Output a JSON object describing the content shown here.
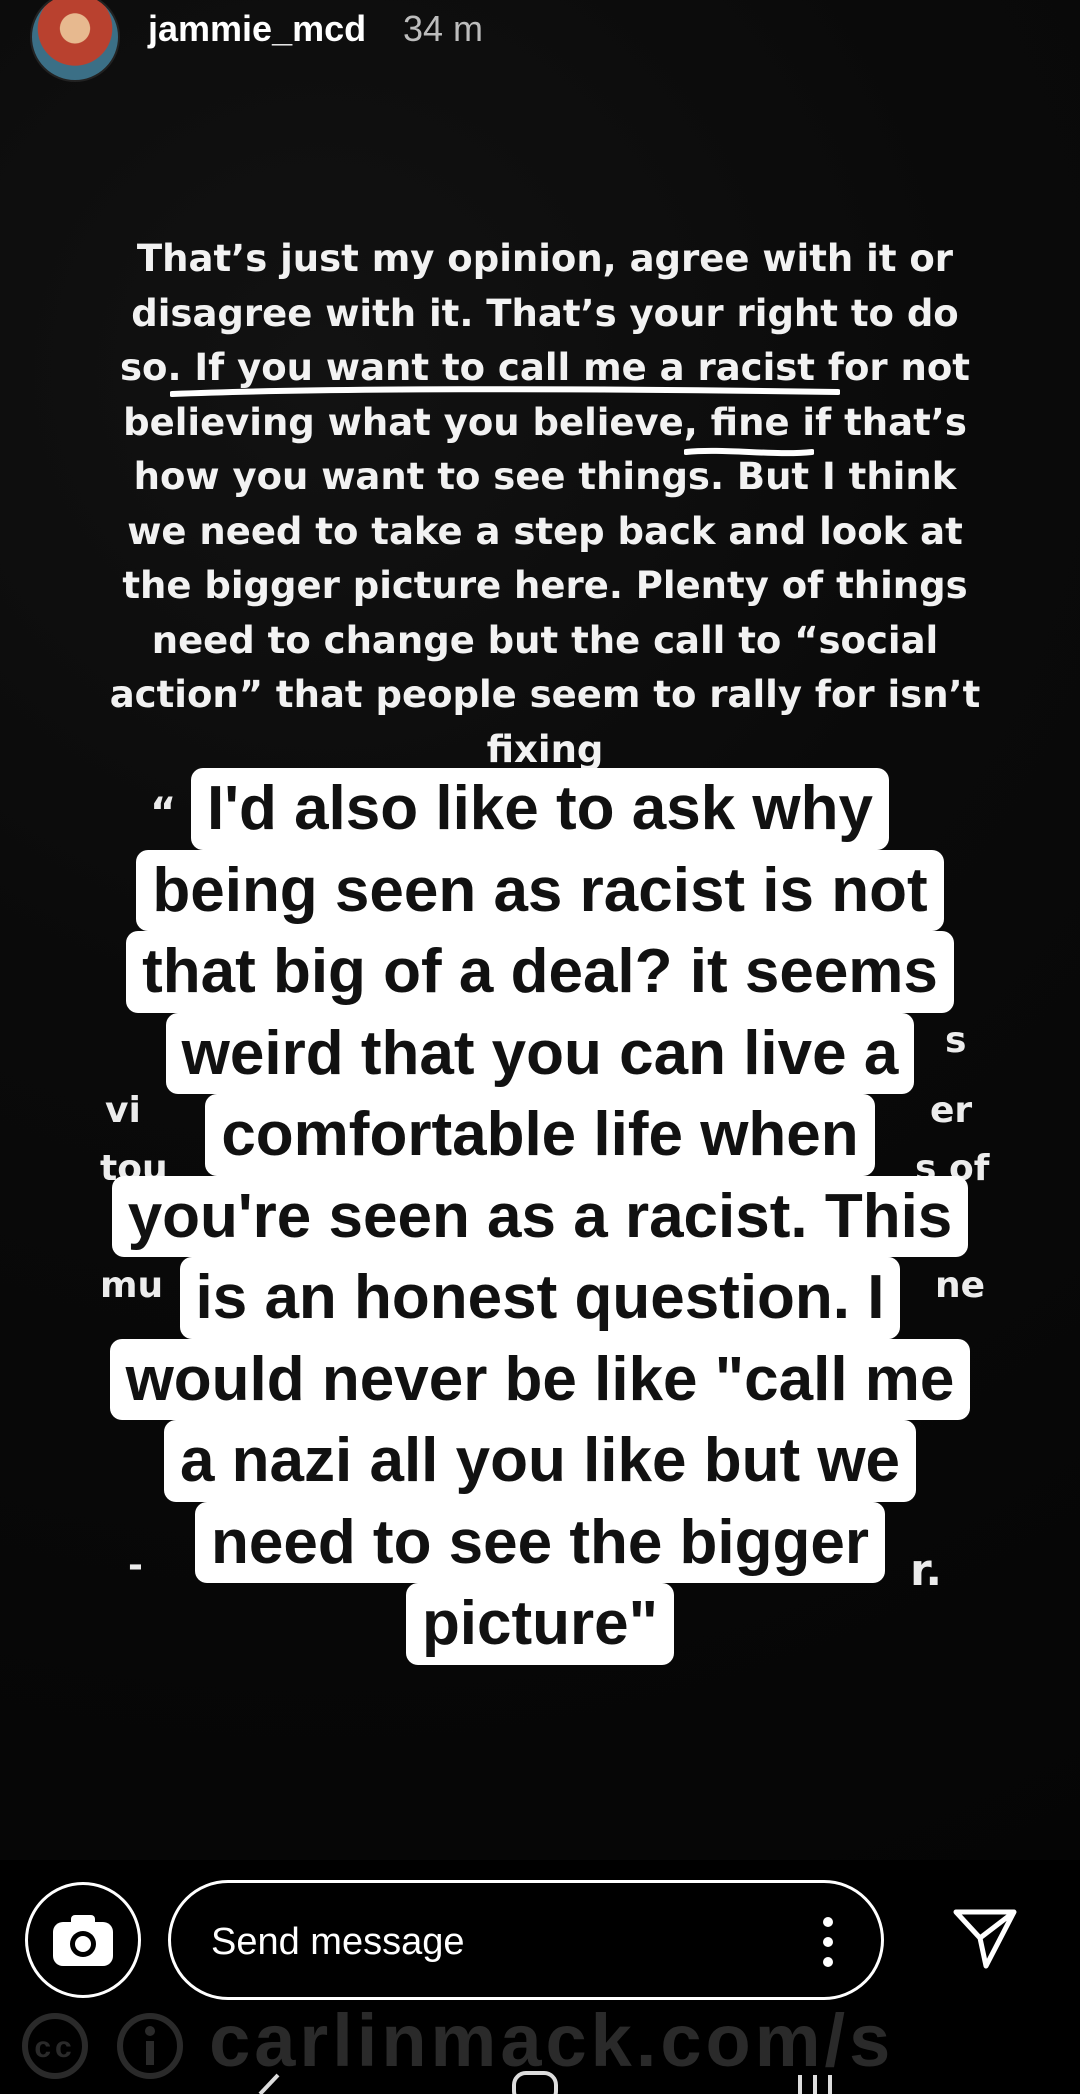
{
  "header": {
    "username": "jammie_mcd",
    "timestamp": "34 m"
  },
  "story": {
    "paragraph": "That’s just my opinion, agree with it or disagree with it. That’s your right to do so. If you want to call me a racist for not believing what you believe, fine if that’s how you want to see things. But I think we need to take a step back and look at the bigger picture here. Plenty of things need to change but the call to “social action” that people seem to rally for isn’t fixing",
    "fragments": [
      "“",
      "s",
      "vi",
      "er",
      "tou",
      "s of",
      "mu",
      "ne",
      "-",
      "r."
    ]
  },
  "overlay": {
    "lines": [
      "I'd also like to ask why",
      "being seen as racist is not",
      "that big of a deal? it seems",
      "weird that you can live a",
      "comfortable life when",
      "you're seen as a racist. This",
      "is an honest question. I",
      "would never be like \"call me",
      "a nazi all you like but we",
      "need to see the bigger",
      "picture\""
    ]
  },
  "bottom_bar": {
    "message_placeholder": "Send message",
    "watermark": "carlinmack.com/s"
  },
  "icons": {
    "camera": "camera-icon",
    "more": "more-vertical-icon",
    "send": "send-icon",
    "cc": "cc-icon",
    "info": "info-icon"
  }
}
